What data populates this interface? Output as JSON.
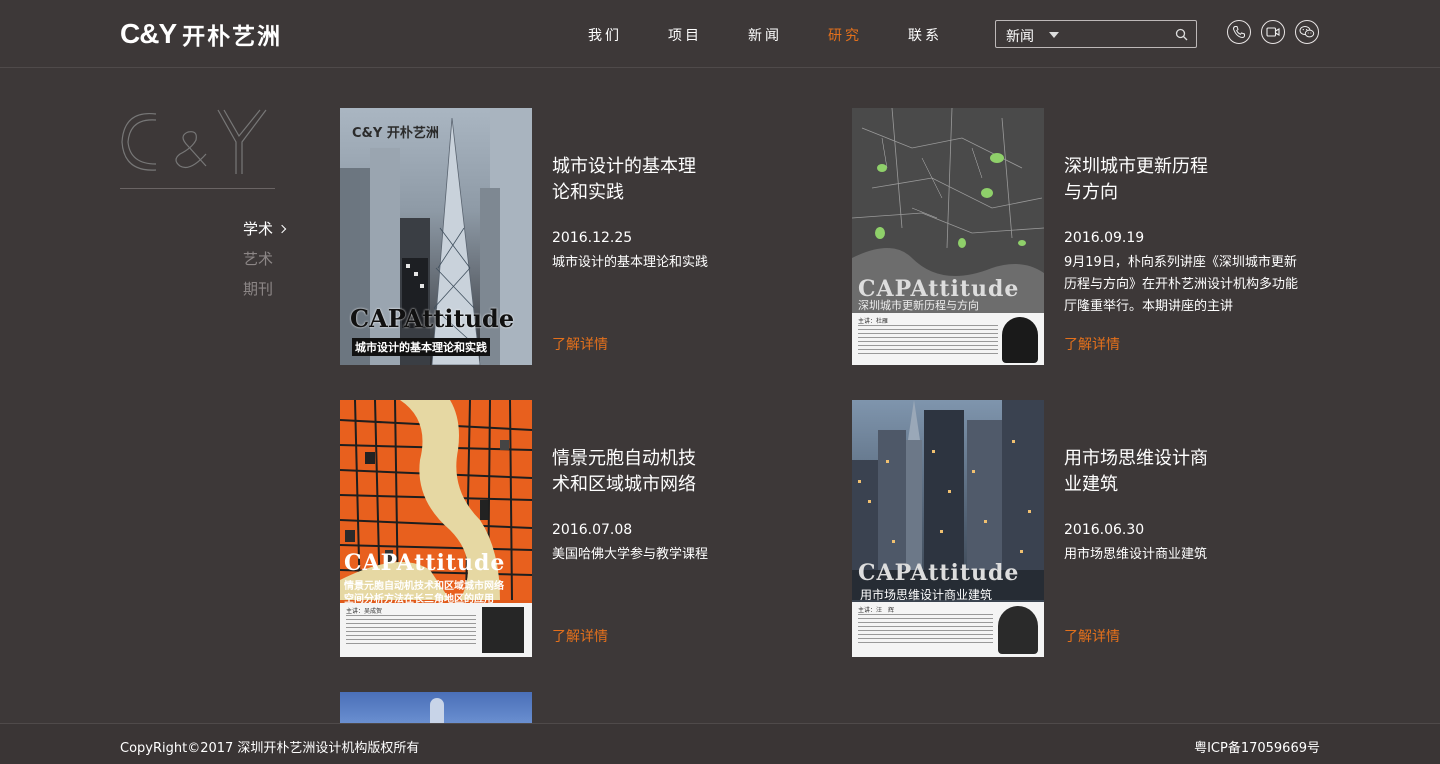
{
  "header": {
    "logo_mark": "C&Y",
    "logo_cn": "开朴艺洲",
    "nav": [
      {
        "label": "我们",
        "active": false
      },
      {
        "label": "项目",
        "active": false
      },
      {
        "label": "新闻",
        "active": false
      },
      {
        "label": "研究",
        "active": true
      },
      {
        "label": "联系",
        "active": false
      }
    ],
    "search": {
      "selected": "新闻",
      "icon": "search-icon"
    },
    "icons": [
      "phone-icon",
      "video-icon",
      "wechat-icon"
    ],
    "accent_color": "#e3701c"
  },
  "sidebar": {
    "items": [
      {
        "label": "学术",
        "active": true
      },
      {
        "label": "艺术",
        "active": false
      },
      {
        "label": "期刊",
        "active": false
      }
    ]
  },
  "cards": [
    {
      "title_line1": "城市设计的基本理",
      "title_line2": "论和实践",
      "date": "2016.12.25",
      "desc": "城市设计的基本理论和实践",
      "more": "了解详情",
      "poster_brand": "C&Y 开朴艺洲",
      "poster_title": "CAPAttitude",
      "poster_subtitle": "城市设计的基本理论和实践"
    },
    {
      "title_line1": "深圳城市更新历程",
      "title_line2": "与方向",
      "date": "2016.09.19",
      "desc": "9月19日，朴向系列讲座《深圳城市更新历程与方向》在开朴艺洲设计机构多功能厅隆重举行。本期讲座的主讲",
      "more": "了解详情",
      "poster_title": "CAPAttitude",
      "poster_subtitle": "深圳城市更新历程与方向",
      "poster_speaker": "主讲：杜雁"
    },
    {
      "title_line1": "情景元胞自动机技",
      "title_line2": "术和区域城市网络",
      "date": "2016.07.08",
      "desc": "美国哈佛大学参与教学课程",
      "more": "了解详情",
      "poster_title": "CAPAttitude",
      "poster_subtitle": "情景元胞自动机技术和区域城市网络",
      "poster_subtitle2": "空间分析方法在长三角地区的应用",
      "poster_speaker": "主讲：吴成贺"
    },
    {
      "title_line1": "用市场思维设计商",
      "title_line2": "业建筑",
      "date": "2016.06.30",
      "desc": "用市场思维设计商业建筑",
      "more": "了解详情",
      "poster_title": "CAPAttitude",
      "poster_subtitle": "用市场思维设计商业建筑",
      "poster_speaker": "主讲：汪　辉"
    }
  ],
  "footer": {
    "copyright": "CopyRight©2017 深圳开朴艺洲设计机构版权所有",
    "icp": "粤ICP备17059669号"
  }
}
